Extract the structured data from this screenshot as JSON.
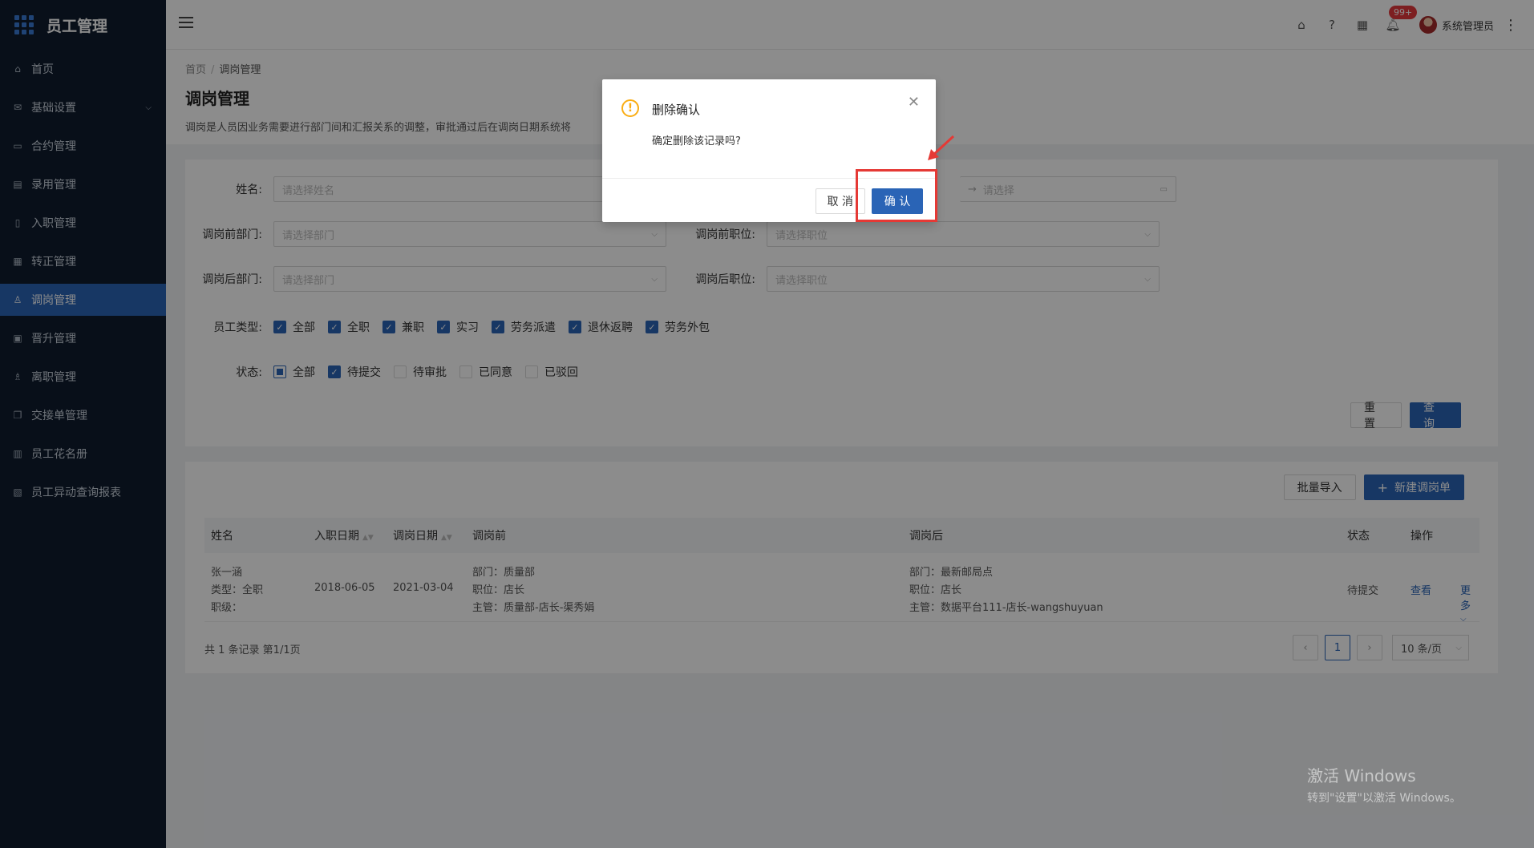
{
  "app": {
    "title": "员工管理"
  },
  "sidebar": {
    "items": [
      {
        "label": "首页",
        "icon": "home-icon",
        "active": false
      },
      {
        "label": "基础设置",
        "icon": "mail-icon",
        "active": false,
        "expandable": true
      },
      {
        "label": "合约管理",
        "icon": "calendar-icon",
        "active": false
      },
      {
        "label": "录用管理",
        "icon": "document-icon",
        "active": false
      },
      {
        "label": "入职管理",
        "icon": "file-icon",
        "active": false
      },
      {
        "label": "转正管理",
        "icon": "grid-icon",
        "active": false
      },
      {
        "label": "调岗管理",
        "icon": "user-icon",
        "active": true
      },
      {
        "label": "晋升管理",
        "icon": "clipboard-icon",
        "active": false
      },
      {
        "label": "离职管理",
        "icon": "user-leave-icon",
        "active": false
      },
      {
        "label": "交接单管理",
        "icon": "copy-icon",
        "active": false
      },
      {
        "label": "员工花名册",
        "icon": "book-icon",
        "active": false
      },
      {
        "label": "员工异动查询报表",
        "icon": "report-icon",
        "active": false
      }
    ]
  },
  "header": {
    "notification_count": "99+",
    "user_name": "系统管理员"
  },
  "page": {
    "breadcrumb": [
      "首页",
      "调岗管理"
    ],
    "title": "调岗管理",
    "description": "调岗是人员因业务需要进行部门间和汇报关系的调整，审批通过后在调岗日期系统将"
  },
  "filters": {
    "name_label": "姓名:",
    "name_placeholder": "请选择姓名",
    "date_end_placeholder": "请选择",
    "before_dept_label": "调岗前部门:",
    "before_dept_placeholder": "请选择部门",
    "before_pos_label": "调岗前职位:",
    "before_pos_placeholder": "请选择职位",
    "after_dept_label": "调岗后部门:",
    "after_dept_placeholder": "请选择部门",
    "after_pos_label": "调岗后职位:",
    "after_pos_placeholder": "请选择职位",
    "emp_type_label": "员工类型:",
    "emp_types": [
      "全部",
      "全职",
      "兼职",
      "实习",
      "劳务派遣",
      "退休返聘",
      "劳务外包"
    ],
    "status_label": "状态:",
    "statuses": [
      "全部",
      "待提交",
      "待审批",
      "已同意",
      "已驳回"
    ],
    "reset": "重 置",
    "query": "查 询"
  },
  "list": {
    "import_label": "批量导入",
    "new_label": "新建调岗单",
    "columns": [
      "姓名",
      "入职日期",
      "调岗日期",
      "调岗前",
      "调岗后",
      "状态",
      "操作"
    ],
    "rows": [
      {
        "name": "张一涵",
        "type": "类型：全职",
        "level": "职级：",
        "hire_date": "2018-06-05",
        "transfer_date": "2021-03-04",
        "before_dept": "部门：质量部",
        "before_pos": "职位：店长",
        "before_mgr": "主管：质量部-店长-渠秀娟",
        "after_dept": "部门：最新邮局点",
        "after_pos": "职位：店长",
        "after_mgr": "主管：数据平台111-店长-wangshuyuan",
        "status": "待提交",
        "view": "查看",
        "more": "更多"
      }
    ],
    "summary": "共 1 条记录 第1/1页",
    "current_page": "1",
    "page_size": "10 条/页"
  },
  "modal": {
    "title": "删除确认",
    "message": "确定删除该记录吗?",
    "cancel": "取 消",
    "confirm": "确 认"
  },
  "watermark": {
    "line1": "激活 Windows",
    "line2": "转到\"设置\"以激活 Windows。"
  }
}
